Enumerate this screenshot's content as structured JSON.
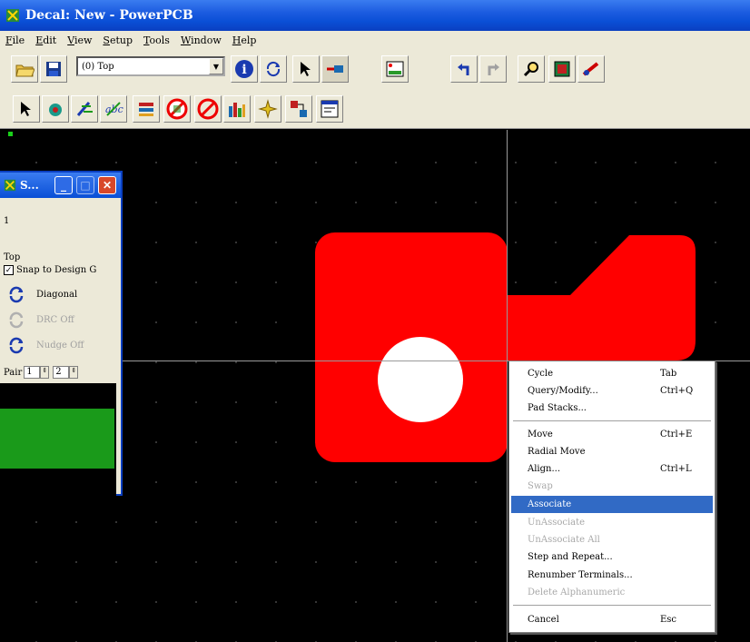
{
  "window": {
    "title": "Decal: New - PowerPCB"
  },
  "menu": [
    "File",
    "Edit",
    "View",
    "Setup",
    "Tools",
    "Window",
    "Help"
  ],
  "toolbar1": {
    "layer_combo_value": "(0) Top",
    "buttons": [
      "open-folder-icon",
      "save-disk-icon",
      "info-icon",
      "refresh-icon",
      "select-arrow-icon",
      "component-icon",
      "board-icon",
      "undo-icon",
      "redo-icon",
      "zoom-icon",
      "board-view-icon",
      "route-icon"
    ]
  },
  "toolbar2": {
    "buttons": [
      "select-arrow-icon",
      "drafting-icon",
      "terminal-edit-icon",
      "text-icon",
      "layer-icon",
      "no-entry-icon",
      "circle-slash-icon",
      "bar-chart-icon",
      "wizard-icon",
      "associate-icon",
      "decal-properties-icon"
    ]
  },
  "float_window": {
    "title": "S...",
    "line1": "1",
    "layer": "Top",
    "snap_label": "Snap to Design G",
    "snap_checked": "✓",
    "diagonal": "Diagonal",
    "drc_off": "DRC Off",
    "nudge_off": "Nudge Off",
    "pair_label": "Pair",
    "pair_val1": "1",
    "pair_val2": "2"
  },
  "context_menu": {
    "items": [
      {
        "label": "Cycle",
        "shortcut": "Tab",
        "disabled": false
      },
      {
        "label": "Query/Modify...",
        "shortcut": "Ctrl+Q",
        "disabled": false
      },
      {
        "label": "Pad Stacks...",
        "shortcut": "",
        "disabled": false
      },
      {
        "label": "Move",
        "shortcut": "Ctrl+E",
        "disabled": false
      },
      {
        "label": "Radial Move",
        "shortcut": "",
        "disabled": false
      },
      {
        "label": "Align...",
        "shortcut": "Ctrl+L",
        "disabled": false
      },
      {
        "label": "Swap",
        "shortcut": "",
        "disabled": true
      },
      {
        "label": "Associate",
        "shortcut": "",
        "disabled": false,
        "highlighted": true
      },
      {
        "label": "UnAssociate",
        "shortcut": "",
        "disabled": true
      },
      {
        "label": "UnAssociate All",
        "shortcut": "",
        "disabled": true
      },
      {
        "label": "Step and Repeat...",
        "shortcut": "",
        "disabled": false
      },
      {
        "label": "Renumber Terminals...",
        "shortcut": "",
        "disabled": false
      },
      {
        "label": "Delete Alphanumeric",
        "shortcut": "",
        "disabled": true
      },
      {
        "label": "Cancel",
        "shortcut": "Esc",
        "disabled": false
      }
    ]
  },
  "colors": {
    "pad": "#ff0000",
    "canvas": "#000000",
    "hole": "#ffffff",
    "highlight": "#316ac5"
  }
}
